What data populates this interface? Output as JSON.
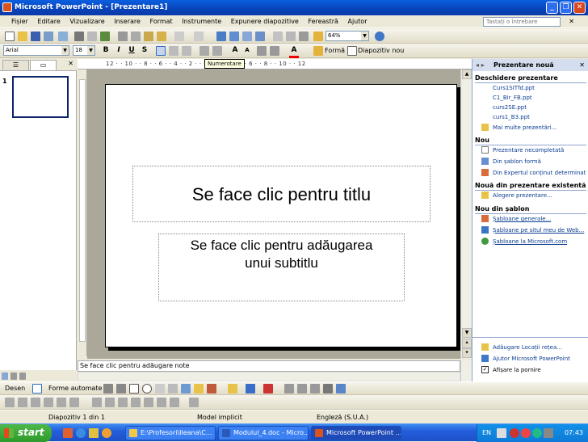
{
  "window": {
    "title": "Microsoft PowerPoint - [Prezentare1]"
  },
  "menu": {
    "items": [
      "Fișier",
      "Editare",
      "Vizualizare",
      "Inserare",
      "Format",
      "Instrumente",
      "Expunere diapozitive",
      "Fereastră",
      "Ajutor"
    ],
    "ask_placeholder": "Tastați o întrebare"
  },
  "standard_toolbar": {
    "zoom": "64%"
  },
  "format_toolbar": {
    "font": "Arial",
    "size": "18",
    "bold": "B",
    "italic": "I",
    "underline": "U",
    "shadow": "S",
    "design_label": "Formă",
    "new_slide_label": "Diapozitiv nou"
  },
  "ruler": {
    "ticks": "12 · · 10 · · 8 · · 6 · · 4 · · 2 · · 0 · · 2 · · 4 · · 6 · · 8 · · 10 · · 12",
    "tooltip": "Numerotare"
  },
  "slides_pane": {
    "tab_outline": "☰",
    "tab_slides": "▭",
    "slide_number": "1"
  },
  "slide": {
    "title_placeholder": "Se face clic pentru titlu",
    "subtitle_line1": "Se face clic pentru adăugarea",
    "subtitle_line2": "unui subtitlu"
  },
  "notes": {
    "placeholder": "Se face clic pentru adăugare note"
  },
  "task_pane": {
    "title": "Prezentare nouă",
    "sections": {
      "open": "Deschidere prezentare",
      "new": "Nou",
      "from_existing": "Nouă din prezentare existentă",
      "from_template": "Nou din șablon"
    },
    "open_files": [
      "Curs1SITfd.ppt",
      "C1_Bir_FB.ppt",
      "curs2SE.ppt",
      "curs1_B3.ppt"
    ],
    "more": "Mai multe prezentări...",
    "new_items": [
      "Prezentare necompletată",
      "Din șablon formă",
      "Din Expertul conținut determinat a"
    ],
    "choose": "Alegere prezentare...",
    "template_items": [
      "Șabloane generale...",
      "Șabloane pe situl meu de Web...",
      "Șabloane la Microsoft.com"
    ],
    "bottom_items": [
      "Adăugare Locații rețea...",
      "Ajutor Microsoft PowerPoint"
    ],
    "show_startup": "Afișare la pornire"
  },
  "drawing_toolbar": {
    "draw": "Desen",
    "autoshapes": "Forme automate"
  },
  "status": {
    "slide": "Diapozitiv 1 din 1",
    "design": "Model implicit",
    "language": "Engleză (S.U.A.)"
  },
  "taskbar": {
    "start": "start",
    "buttons": [
      "E:\\Profesori\\Ileana\\C...",
      "Modulul_4.doc - Micro...",
      "Microsoft PowerPoint ..."
    ],
    "lang": "EN",
    "clock": "07:43"
  },
  "colors": {
    "title_bar": "#0842b8",
    "task_pane_header": "#d5deef",
    "start_button": "#2d9a2b",
    "link": "#0b3d91"
  }
}
